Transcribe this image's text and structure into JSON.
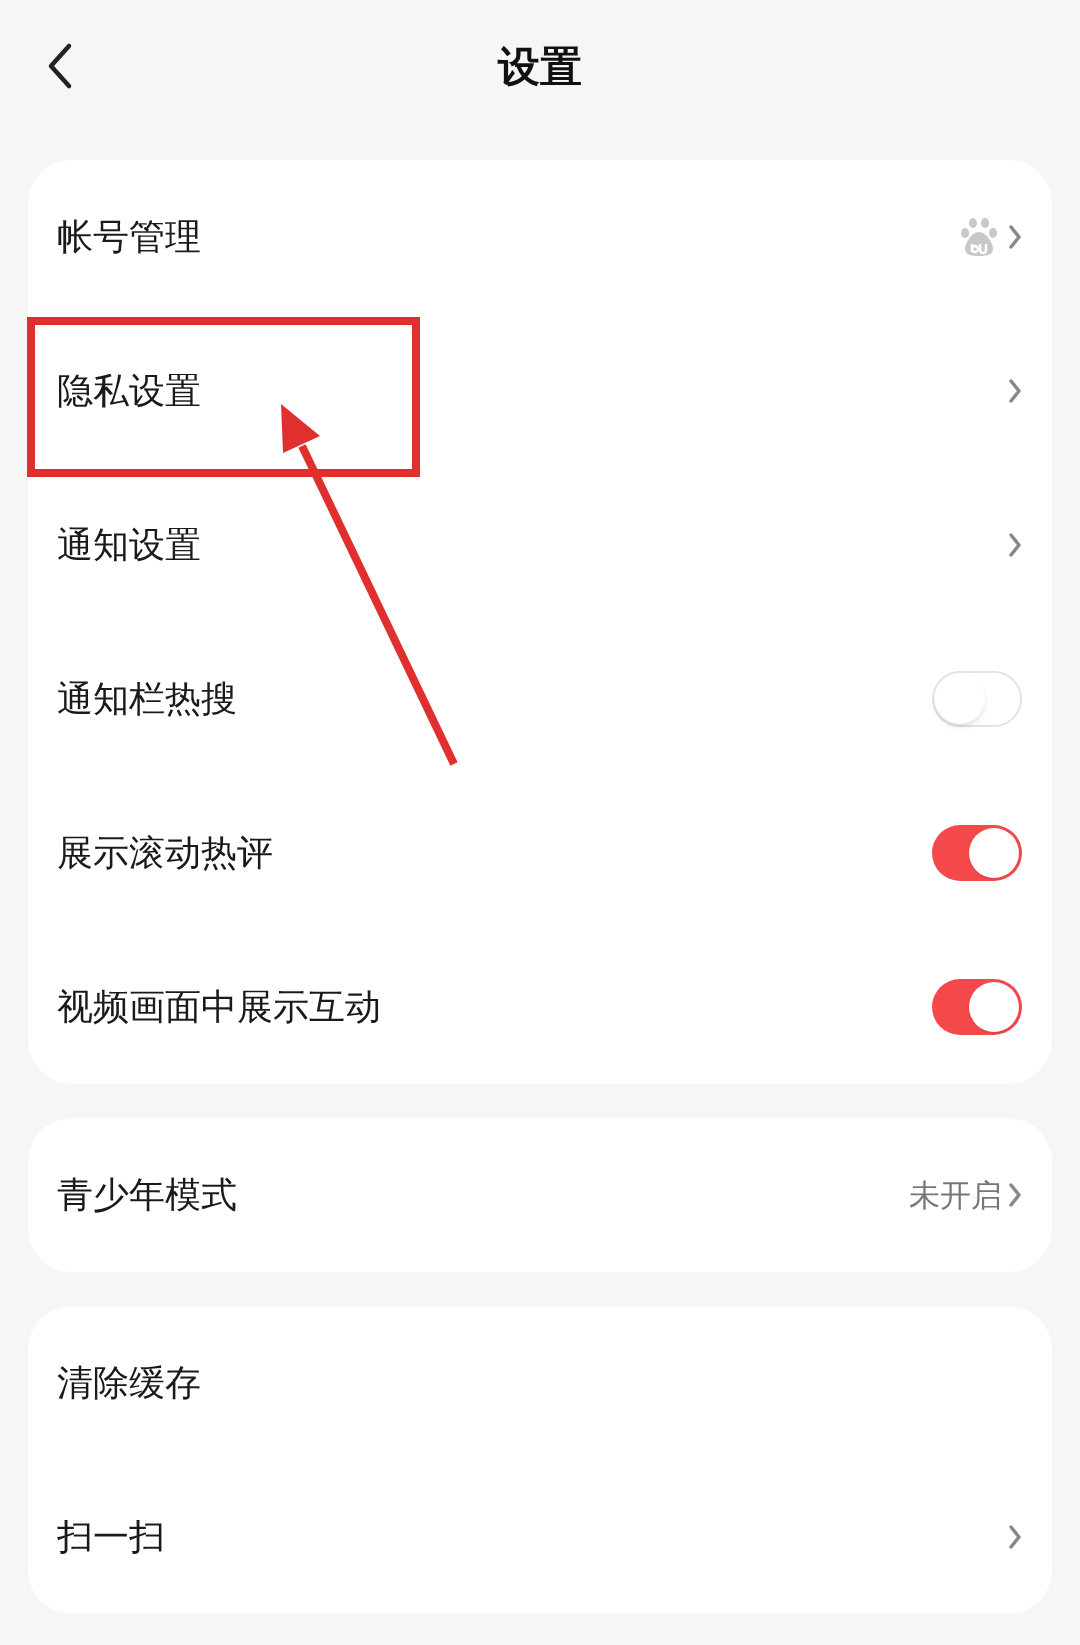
{
  "header": {
    "title": "设置"
  },
  "groups": [
    {
      "rows": [
        {
          "kind": "account",
          "label": "帐号管理"
        },
        {
          "kind": "link",
          "label": "隐私设置"
        },
        {
          "kind": "link",
          "label": "通知设置"
        },
        {
          "kind": "toggle",
          "label": "通知栏热搜",
          "on": false
        },
        {
          "kind": "toggle",
          "label": "展示滚动热评",
          "on": true
        },
        {
          "kind": "toggle",
          "label": "视频画面中展示互动",
          "on": true
        }
      ]
    },
    {
      "rows": [
        {
          "kind": "link",
          "label": "青少年模式",
          "value": "未开启"
        }
      ]
    },
    {
      "rows": [
        {
          "kind": "plain",
          "label": "清除缓存"
        },
        {
          "kind": "link",
          "label": "扫一扫"
        }
      ]
    }
  ]
}
